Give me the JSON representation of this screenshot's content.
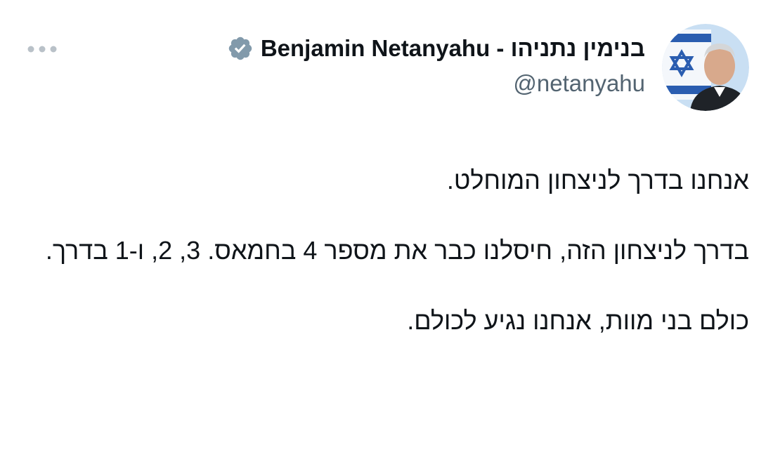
{
  "author": {
    "display_name": "בנימין נתניהו - Benjamin Netanyahu",
    "handle": "@netanyahu",
    "verified": true,
    "verified_color": "#829aab",
    "avatar_icon": "profile-photo-israeli-flag"
  },
  "menu": {
    "icon": "more-horizontal-icon"
  },
  "tweet": {
    "paragraphs": [
      "אנחנו בדרך לניצחון המוחלט.",
      "בדרך לניצחון הזה, חיסלנו כבר את מספר 4 בחמאס. 3, 2, ו-1 בדרך.",
      "כולם בני מוות, אנחנו נגיע לכולם."
    ]
  },
  "colors": {
    "text": "#0f1419",
    "secondary": "#536471",
    "background": "#ffffff"
  }
}
